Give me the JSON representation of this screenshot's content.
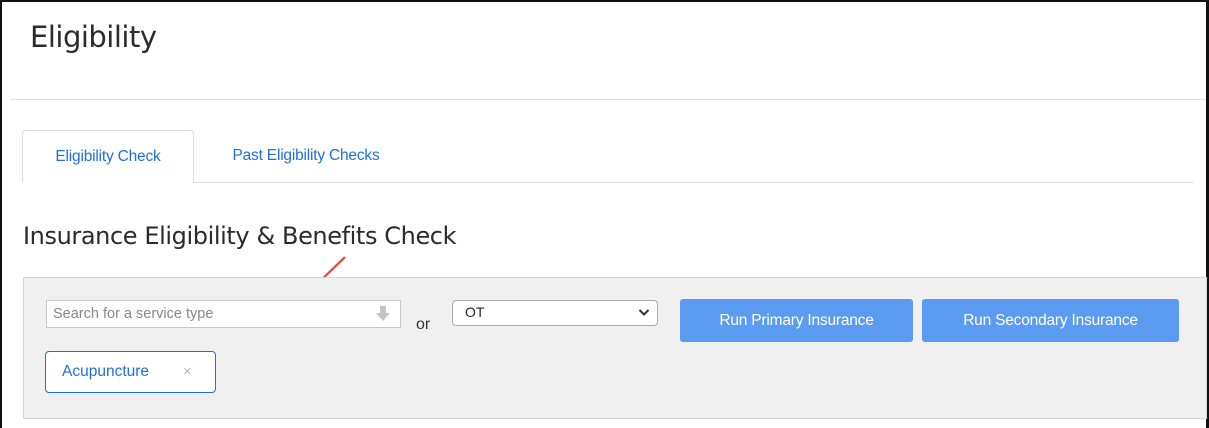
{
  "header": {
    "title": "Eligibility"
  },
  "tabs": [
    {
      "label": "Eligibility Check",
      "active": true
    },
    {
      "label": "Past Eligibility Checks",
      "active": false
    }
  ],
  "section": {
    "title": "Insurance Eligibility & Benefits Check"
  },
  "form": {
    "service_search": {
      "placeholder": "Search for a service type",
      "value": ""
    },
    "or_label": "or",
    "service_select": {
      "selected": "OT"
    },
    "run_primary_label": "Run Primary Insurance",
    "run_secondary_label": "Run Secondary Insurance",
    "selected_chip": {
      "label": "Acupuncture",
      "remove": "×"
    }
  },
  "colors": {
    "accent": "#1f6fe0",
    "button_bg": "#5b9bf2",
    "panel_bg": "#f0f0f0",
    "annotation_arrow": "#e8452c"
  },
  "icons": {
    "input_dropdown": "down-arrow-icon",
    "select_dropdown": "chevron-down-icon",
    "chip_remove": "close-icon",
    "annotation": "pointer-arrow-icon"
  }
}
